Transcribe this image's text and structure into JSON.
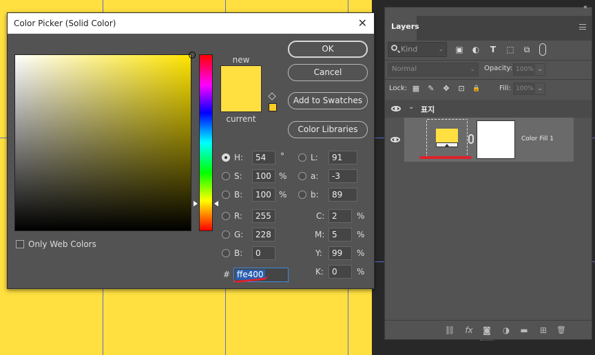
{
  "colors": {
    "fill": "#ffe040",
    "accent_red": "#e0202a",
    "selection_blue": "#2a5fb0",
    "panel": "#535353"
  },
  "color_picker": {
    "title": "Color Picker (Solid Color)",
    "close_glyph": "✕",
    "new_label": "new",
    "current_label": "current",
    "buttons": {
      "ok": "OK",
      "cancel": "Cancel",
      "add_to_swatches": "Add to Swatches",
      "color_libraries": "Color Libraries"
    },
    "only_web_colors": "Only Web Colors",
    "hsb": {
      "h_label": "H:",
      "h": "54",
      "h_unit": "°",
      "s_label": "S:",
      "s": "100",
      "s_unit": "%",
      "b_label": "B:",
      "b": "100",
      "b_unit": "%"
    },
    "rgb": {
      "r_label": "R:",
      "r": "255",
      "g_label": "G:",
      "g": "228",
      "b_label": "B:",
      "b": "0"
    },
    "lab": {
      "l_label": "L:",
      "l": "91",
      "a_label": "a:",
      "a": "-3",
      "b_label": "b:",
      "b": "89"
    },
    "cmyk": {
      "c_label": "C:",
      "c": "2",
      "m_label": "M:",
      "m": "5",
      "y_label": "Y:",
      "y": "99",
      "k_label": "K:",
      "k": "0",
      "unit": "%"
    },
    "hex_label": "#",
    "hex": "ffe400"
  },
  "layers_panel": {
    "tab": "Layers",
    "kind_placeholder": "Kind",
    "blend_mode": "Normal",
    "opacity_label": "Opacity:",
    "opacity_value": "100%",
    "lock_label": "Lock:",
    "fill_label": "Fill:",
    "fill_value": "100%",
    "group_name": "표지",
    "layer_name": "Color Fill 1",
    "filter_icons": {
      "pixel": "▣",
      "adjust": "◐",
      "type": "T",
      "shape": "⬚",
      "smart": "⧉"
    },
    "lock_icons": {
      "transparent": "▦",
      "brush": "✎",
      "move": "✥",
      "artboard": "⊡",
      "all": "🔒"
    },
    "footer_icons": {
      "link": "⛓",
      "fx": "fx",
      "mask": "◙",
      "adjust": "◑",
      "folder": "▬",
      "new": "⊞",
      "trash": "🗑"
    }
  }
}
